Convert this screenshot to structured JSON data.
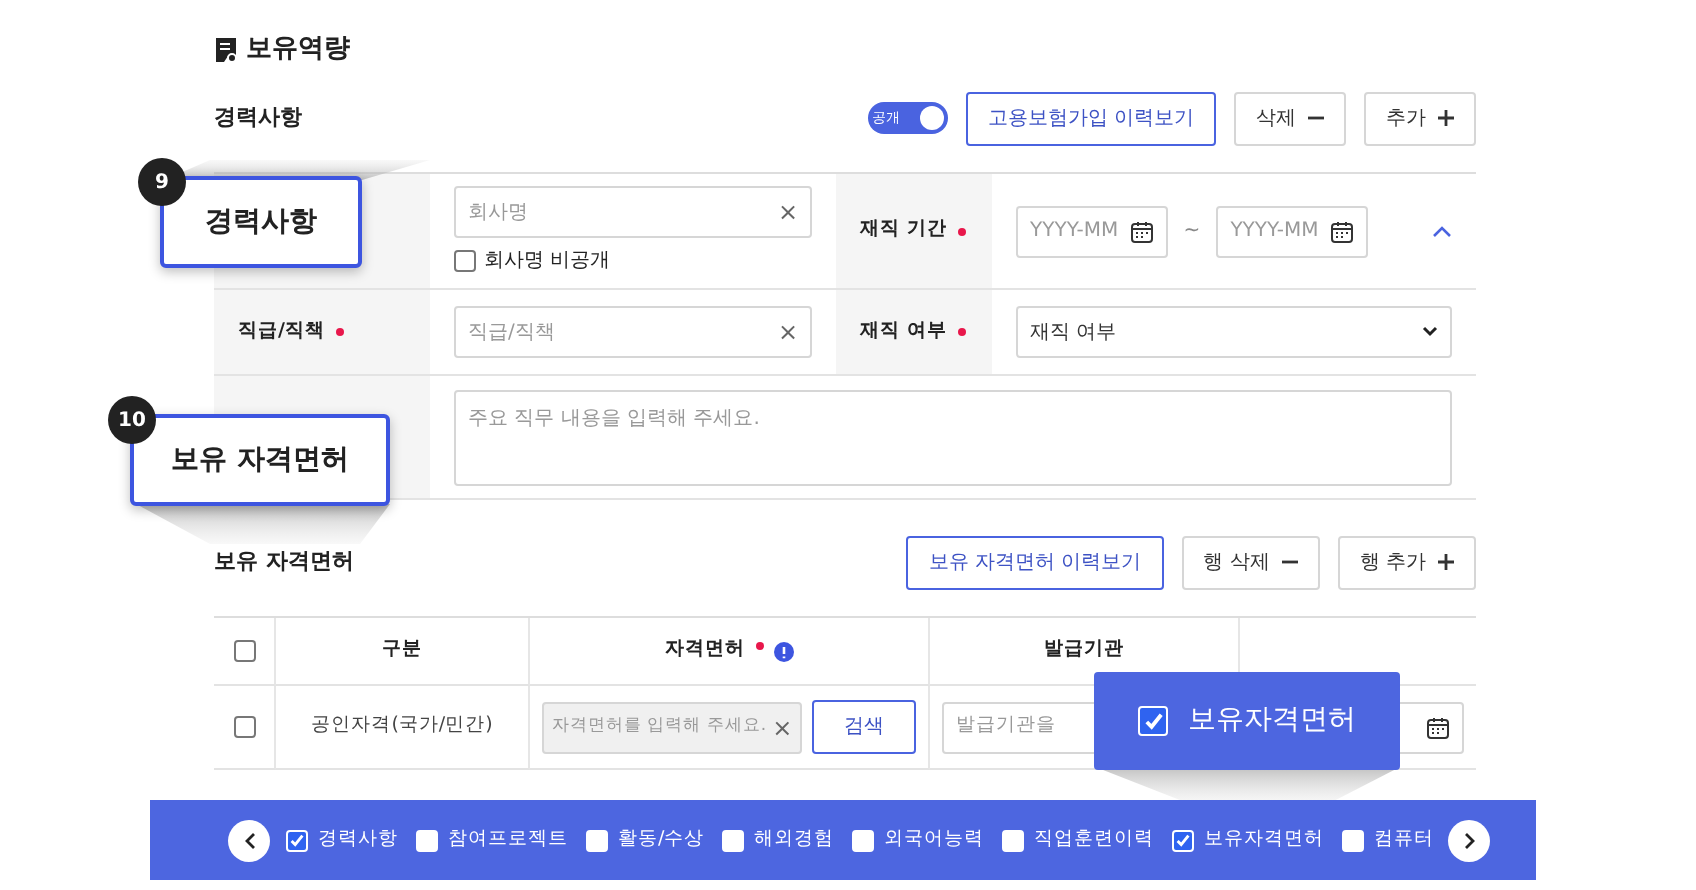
{
  "page_title": "보유역량",
  "career": {
    "heading": "경력사항",
    "visibility": {
      "label": "공개",
      "on": true
    },
    "buttons": [
      {
        "label": "고용보험가입 이력보기",
        "kind": "outline"
      },
      {
        "label": "삭제",
        "kind": "remove"
      },
      {
        "label": "추가",
        "kind": "add"
      }
    ],
    "company": {
      "placeholder": "회사명",
      "clear": "×"
    },
    "hide_company": {
      "label": "회사명 비공개",
      "checked": false
    },
    "period": {
      "label": "재직 기간",
      "required": true,
      "start_placeholder": "YYYY-MM",
      "separator": "~",
      "end_placeholder": "YYYY-MM"
    },
    "expanded": true,
    "position": {
      "label": "직급/직책",
      "required": true,
      "placeholder": "직급/직책",
      "clear": "×"
    },
    "employment": {
      "label": "재직 여부",
      "required": true,
      "value": "재직 여부"
    },
    "duties": {
      "placeholder": "주요 직무 내용을 입력해 주세요."
    }
  },
  "licenses": {
    "heading": "보유 자격면허",
    "buttons": [
      {
        "label": "보유 자격면허 이력보기",
        "kind": "outline"
      },
      {
        "label": "행 삭제",
        "kind": "remove"
      },
      {
        "label": "행 추가",
        "kind": "add"
      }
    ],
    "select_all": {
      "checked": false
    },
    "columns": [
      {
        "label": "구분"
      },
      {
        "label": "자격면허",
        "required": true,
        "info": true
      },
      {
        "label": "발급기관"
      }
    ],
    "rows": [
      {
        "checked": false,
        "category": "공인자격(국가/민간)",
        "license_placeholder": "자격면허를 입력해 주세요.",
        "clear": "×",
        "search": "검색",
        "issuer_placeholder": "발급기관을"
      }
    ]
  },
  "section_nav": {
    "items": [
      {
        "label": "경력사항",
        "checked": true
      },
      {
        "label": "참여프로젝트",
        "checked": false
      },
      {
        "label": "활동/수상",
        "checked": false
      },
      {
        "label": "해외경험",
        "checked": false
      },
      {
        "label": "외국어능력",
        "checked": false
      },
      {
        "label": "직업훈련이력",
        "checked": false
      },
      {
        "label": "보유자격면허",
        "checked": true
      },
      {
        "label": "컴퓨터",
        "checked": false
      }
    ]
  },
  "callouts": [
    {
      "kind": "numbered",
      "number": "9",
      "label": "경력사항"
    },
    {
      "kind": "numbered",
      "number": "10",
      "label": "보유 자격면허"
    },
    {
      "kind": "checkbox",
      "label": "보유자격면허",
      "checked": true
    }
  ]
}
